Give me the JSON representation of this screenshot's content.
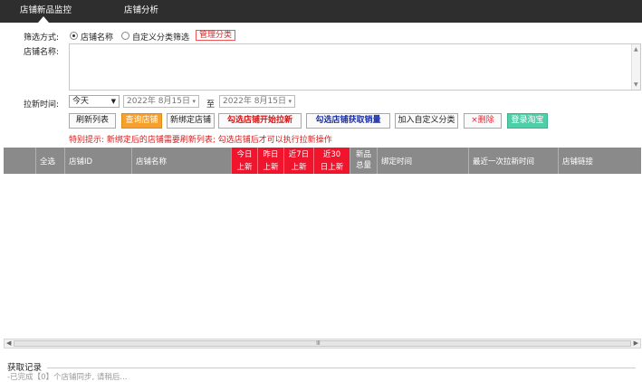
{
  "tabs": [
    {
      "label": "店铺新品监控",
      "active": true
    },
    {
      "label": "店铺分析",
      "active": false
    }
  ],
  "filter": {
    "label": "筛选方式:",
    "options": [
      "店铺名称",
      "自定义分类筛选"
    ],
    "selected": "店铺名称",
    "manage_label": "管理分类"
  },
  "shop_name": {
    "label": "店铺名称:",
    "value": ""
  },
  "pull_time": {
    "label": "拉新时间:",
    "range_value": "今天",
    "start_date": "2022年 8月15日",
    "separator": "至",
    "end_date": "2022年 8月15日"
  },
  "buttons": {
    "refresh": "刷新列表",
    "query": "查询店铺",
    "bind": "新绑定店铺",
    "start_pull": "勾选店铺开始拉新",
    "fetch_sales": "勾选店铺获取销量",
    "add_category": "加入自定义分类",
    "delete": "×删除",
    "login": "登录淘宝"
  },
  "notice": "特别提示: 新绑定后的店铺需要刷新列表; 勾选店铺后才可以执行拉新操作",
  "table": {
    "headers": {
      "select_all": "全选",
      "shop_id": "店铺ID",
      "shop_name": "店铺名称",
      "today_l1": "今日",
      "today_l2": "上新",
      "yesterday_l1": "昨日",
      "yesterday_l2": "上新",
      "week_l1": "近7日",
      "week_l2": "上新",
      "month_l1": "近30",
      "month_l2": "日上新",
      "total_l1": "新品",
      "total_l2": "总量",
      "bind_time": "绑定时间",
      "last_pull": "最近一次拉新时间",
      "link": "店铺链接"
    },
    "rows": []
  },
  "footer": {
    "title": "获取记录",
    "log": "-已完成【0】个店铺同步, 请稍后..."
  },
  "colors": {
    "tab_bar": "#2e2e2e",
    "accent_red": "#f0142c",
    "orange": "#f6a02f",
    "green": "#4fcfa8"
  }
}
